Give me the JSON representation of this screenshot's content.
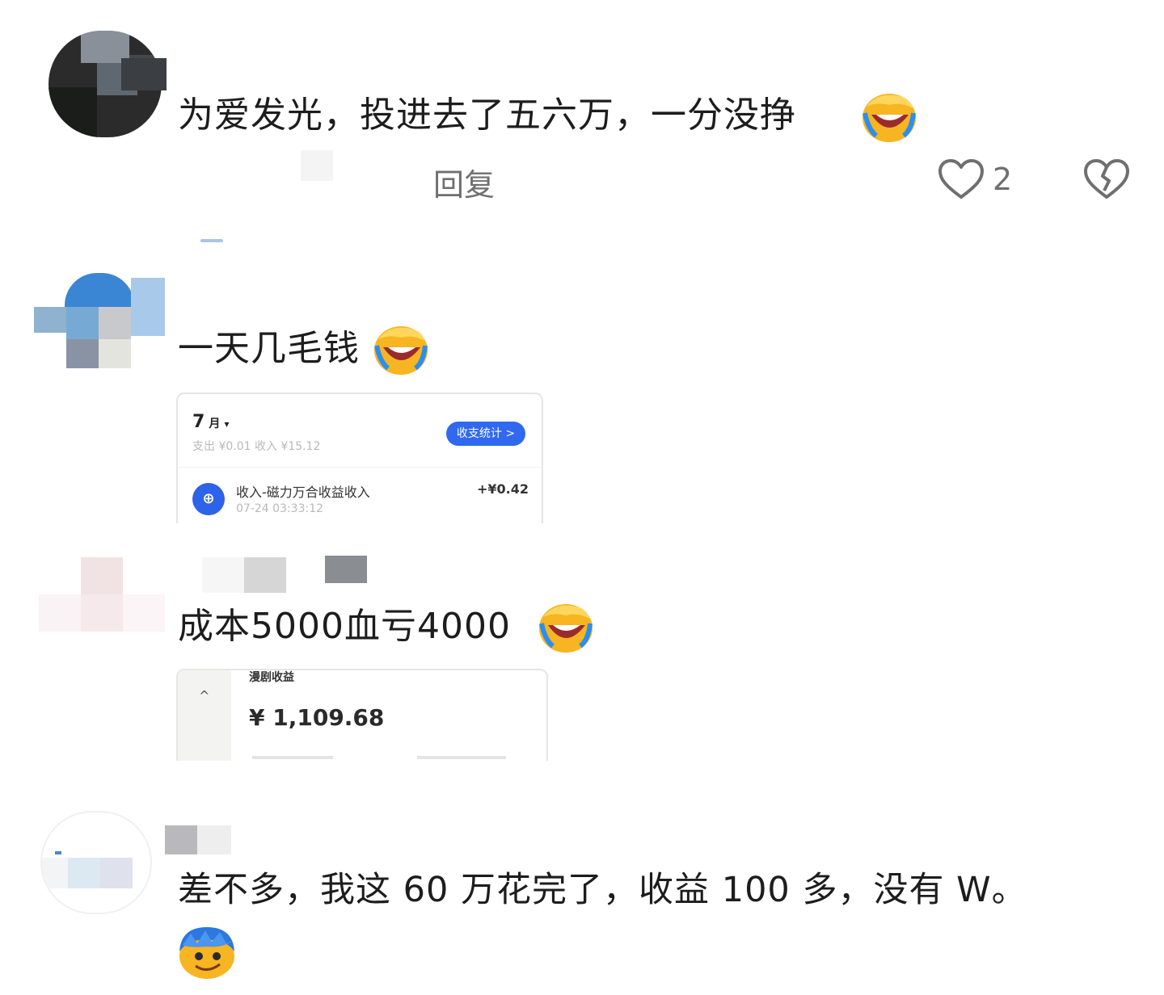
{
  "comments": [
    {
      "text": "为爱发光，投进去了五六万，一分没挣",
      "emoji": "facepalm-laugh-emoji",
      "reply_label": "回复",
      "like_count": "2"
    },
    {
      "text": "一天几毛钱",
      "emoji": "facepalm-laugh-emoji",
      "attachment": {
        "month": "7",
        "month_unit": "月",
        "summary": "支出 ¥0.01    收入 ¥15.12",
        "stats_button": "收支统计 >",
        "record_title": "收入-磁力万合收益收入",
        "record_time": "07-24 03:33:12",
        "record_amount": "+¥0.42"
      }
    },
    {
      "text": "成本5000血亏4000",
      "emoji": "facepalm-laugh-emoji",
      "attachment": {
        "header": "漫剧收益",
        "amount": "¥ 1,109.68",
        "caret": "^"
      }
    },
    {
      "text": "差不多，我这 60 万花完了，收益 100 多，没有 W。",
      "emoji": "blue-hair-smile-emoji"
    }
  ],
  "colors": {
    "accent_blue": "#3068f0",
    "text_main": "#1d1d1d",
    "text_secondary": "#6f6f6f"
  }
}
